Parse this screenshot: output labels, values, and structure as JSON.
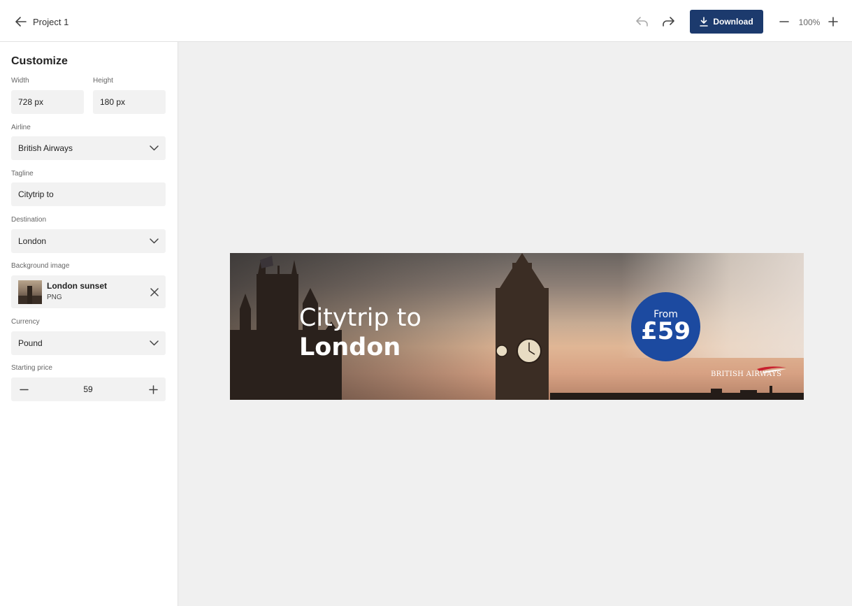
{
  "header": {
    "project_title": "Project 1",
    "download_label": "Download",
    "zoom_level": "100%"
  },
  "sidebar": {
    "title": "Customize",
    "width": {
      "label": "Width",
      "value": "728 px"
    },
    "height": {
      "label": "Height",
      "value": "180 px"
    },
    "airline": {
      "label": "Airline",
      "value": "British Airways"
    },
    "tagline": {
      "label": "Tagline",
      "value": "Citytrip to"
    },
    "destination": {
      "label": "Destination",
      "value": "London"
    },
    "background_image": {
      "label": "Background image",
      "name": "London sunset",
      "type": "PNG"
    },
    "currency": {
      "label": "Currency",
      "value": "Pound"
    },
    "starting_price": {
      "label": "Starting price",
      "value": "59"
    }
  },
  "banner": {
    "tagline": "Citytrip to",
    "destination": "London",
    "price_prefix": "From",
    "price": "£59",
    "airline_logo_text": "BRITISH AIRWAYS",
    "accent_color": "#1c4aa0"
  },
  "colors": {
    "primary_button": "#1c3a6d",
    "price_badge": "#1c4aa0"
  },
  "icons": {
    "back": "arrow-left-icon",
    "undo": "undo-icon",
    "redo": "redo-icon",
    "download": "download-icon",
    "zoom_out": "minus-icon",
    "zoom_in": "plus-icon",
    "select": "chevron-down-icon",
    "remove": "close-icon"
  }
}
